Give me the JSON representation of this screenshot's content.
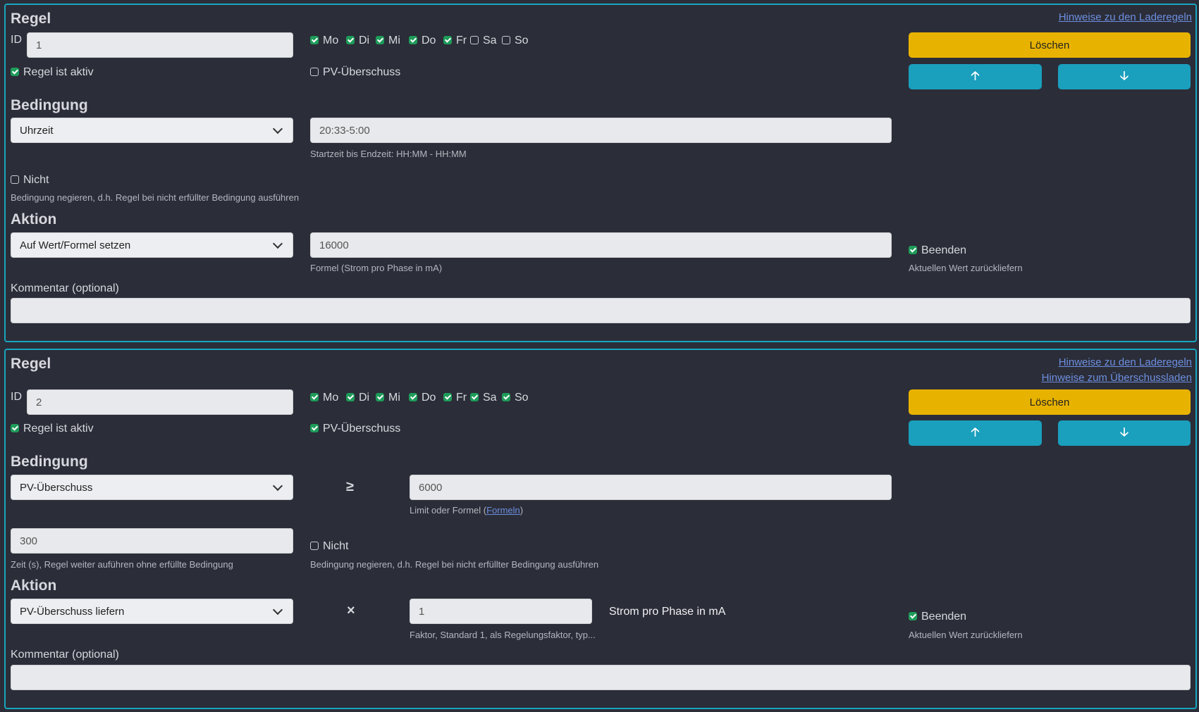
{
  "links": {
    "hints_charge_rules": "Hinweise zu den Laderegeln",
    "hints_surplus": "Hinweise zum Überschussladen"
  },
  "labels": {
    "rule_heading": "Regel",
    "id": "ID",
    "rule_active": "Regel ist aktiv",
    "pv_surplus": "PV-Überschuss",
    "condition_heading": "Bedingung",
    "action_heading": "Aktion",
    "not": "Nicht",
    "not_help": "Bedingung negieren, d.h. Regel bei nicht erfüllter Bedingung ausführen",
    "finish": "Beenden",
    "finish_help": "Aktuellen Wert zurückliefern",
    "comment": "Kommentar (optional)",
    "delete": "Löschen"
  },
  "icons": {
    "up": "arrow-up-icon",
    "down": "arrow-down-icon"
  },
  "colors": {
    "accent": "#1aa5bf",
    "delete": "#e8b300",
    "check": "#1e9c5a"
  },
  "rule1": {
    "id": "1",
    "days": [
      {
        "label": "Mo",
        "checked": true
      },
      {
        "label": "Di",
        "checked": true
      },
      {
        "label": "Mi",
        "checked": true
      },
      {
        "label": "Do",
        "checked": true
      },
      {
        "label": "Fr",
        "checked": true
      },
      {
        "label": "Sa",
        "checked": false
      },
      {
        "label": "So",
        "checked": false
      }
    ],
    "active": true,
    "pv_surplus": false,
    "condition_type": "Uhrzeit",
    "condition_value": "20:33-5:00",
    "condition_help": "Startzeit bis Endzeit: HH:MM - HH:MM",
    "not_checked": false,
    "action_type": "Auf Wert/Formel setzen",
    "action_value": "16000",
    "action_help": "Formel (Strom pro Phase in mA)",
    "finish_checked": true,
    "comment": ""
  },
  "rule2": {
    "id": "2",
    "days": [
      {
        "label": "Mo",
        "checked": true
      },
      {
        "label": "Di",
        "checked": true
      },
      {
        "label": "Mi",
        "checked": true
      },
      {
        "label": "Do",
        "checked": true
      },
      {
        "label": "Fr",
        "checked": true
      },
      {
        "label": "Sa",
        "checked": true
      },
      {
        "label": "So",
        "checked": true
      }
    ],
    "active": true,
    "pv_surplus": true,
    "condition_type": "PV-Überschuss",
    "condition_operator": "≥",
    "condition_value": "6000",
    "condition_help_prefix": "Limit oder Formel (",
    "condition_help_link": "Formeln",
    "condition_help_suffix": ")",
    "time_value": "300",
    "time_help": "Zeit (s), Regel weiter auführen ohne erfüllte Bedingung",
    "not_checked": false,
    "action_type": "PV-Überschuss liefern",
    "action_operator": "×",
    "action_value": "1",
    "action_unit": "Strom pro Phase in mA",
    "action_help": "Faktor, Standard 1, als Regelungsfaktor, typ...",
    "finish_checked": true,
    "comment": ""
  }
}
